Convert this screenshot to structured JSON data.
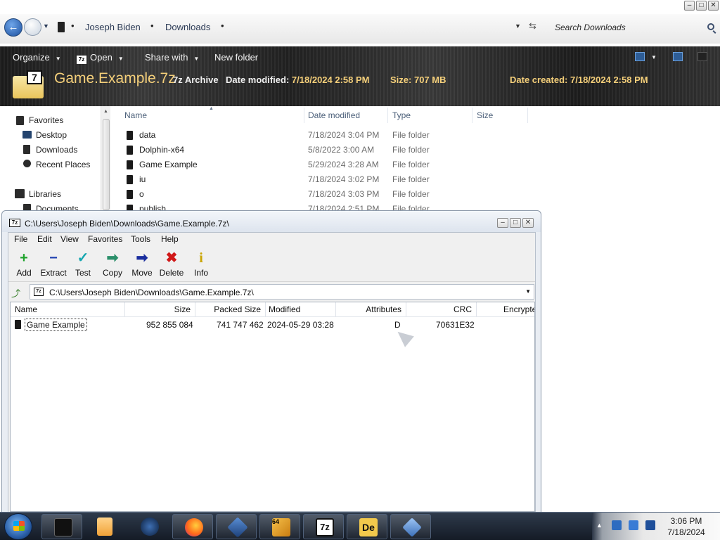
{
  "explorer": {
    "caption_buttons": [
      "–",
      "□",
      "✕"
    ],
    "breadcrumb": [
      "Joseph Biden",
      "Downloads"
    ],
    "search_placeholder": "Search Downloads",
    "command_bar": {
      "organize": "Organize",
      "open": "Open",
      "share_with": "Share with",
      "new_folder": "New folder"
    },
    "details": {
      "file_name": "Game.Example.7z",
      "file_type": "7z Archive",
      "date_modified_label": "Date modified:",
      "date_modified": "7/18/2024 2:58 PM",
      "size_label": "Size:",
      "size": "707 MB",
      "date_created_label": "Date created:",
      "date_created": "7/18/2024 2:58 PM"
    },
    "nav_pane": {
      "favorites": "Favorites",
      "desktop": "Desktop",
      "downloads": "Downloads",
      "recent_places": "Recent Places",
      "libraries": "Libraries",
      "documents": "Documents"
    },
    "columns": [
      "Name",
      "Date modified",
      "Type",
      "Size"
    ],
    "rows": [
      {
        "name": "data",
        "date": "7/18/2024 3:04 PM",
        "type": "File folder"
      },
      {
        "name": "Dolphin-x64",
        "date": "5/8/2022 3:00 AM",
        "type": "File folder"
      },
      {
        "name": "Game Example",
        "date": "5/29/2024 3:28 AM",
        "type": "File folder"
      },
      {
        "name": "iu",
        "date": "7/18/2024 3:02 PM",
        "type": "File folder"
      },
      {
        "name": "o",
        "date": "7/18/2024 3:03 PM",
        "type": "File folder"
      },
      {
        "name": "publish",
        "date": "7/18/2024 2:51 PM",
        "type": "File folder"
      }
    ]
  },
  "zip": {
    "icon_label": "7z",
    "title": "C:\\Users\\Joseph Biden\\Downloads\\Game.Example.7z\\",
    "caption_buttons": [
      "–",
      "□",
      "✕"
    ],
    "menu": [
      "File",
      "Edit",
      "View",
      "Favorites",
      "Tools",
      "Help"
    ],
    "toolbar": [
      {
        "label": "Add",
        "icon": "+",
        "color": "#1fa32c"
      },
      {
        "label": "Extract",
        "icon": "−",
        "color": "#1d3fb0"
      },
      {
        "label": "Test",
        "icon": "✓",
        "color": "#17a7b0"
      },
      {
        "label": "Copy",
        "icon": "➡",
        "color": "#2b8f6a"
      },
      {
        "label": "Move",
        "icon": "➡",
        "color": "#1a2e9e"
      },
      {
        "label": "Delete",
        "icon": "✖",
        "color": "#d01818"
      },
      {
        "label": "Info",
        "icon": "i",
        "color": "#c9a400"
      }
    ],
    "path": "C:\\Users\\Joseph Biden\\Downloads\\Game.Example.7z\\",
    "columns": [
      "Name",
      "Size",
      "Packed Size",
      "Modified",
      "Attributes",
      "CRC",
      "Encrypte"
    ],
    "row": {
      "name": "Game Example",
      "size": "952 855 084",
      "packed_size": "741 747 462",
      "modified": "2024-05-29 03:28",
      "attributes": "D",
      "crc": "70631E32"
    }
  },
  "taskbar": {
    "apps": [
      "terminal",
      "media-player",
      "browser-globe",
      "firefox",
      "virtualbox",
      "app-64",
      "7zip",
      "de-app",
      "network-app"
    ],
    "icon_labels": {
      "app64": "64",
      "sevenzip": "7z",
      "de": "De"
    },
    "clock_time": "3:06 PM",
    "clock_date": "7/18/2024"
  }
}
